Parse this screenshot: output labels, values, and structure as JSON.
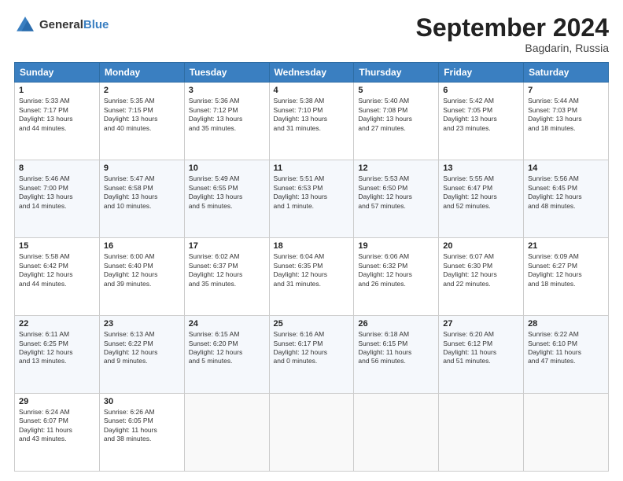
{
  "header": {
    "logo_general": "General",
    "logo_blue": "Blue",
    "title": "September 2024",
    "location": "Bagdarin, Russia"
  },
  "weekdays": [
    "Sunday",
    "Monday",
    "Tuesday",
    "Wednesday",
    "Thursday",
    "Friday",
    "Saturday"
  ],
  "weeks": [
    [
      {
        "day": "1",
        "lines": [
          "Sunrise: 5:33 AM",
          "Sunset: 7:17 PM",
          "Daylight: 13 hours",
          "and 44 minutes."
        ]
      },
      {
        "day": "2",
        "lines": [
          "Sunrise: 5:35 AM",
          "Sunset: 7:15 PM",
          "Daylight: 13 hours",
          "and 40 minutes."
        ]
      },
      {
        "day": "3",
        "lines": [
          "Sunrise: 5:36 AM",
          "Sunset: 7:12 PM",
          "Daylight: 13 hours",
          "and 35 minutes."
        ]
      },
      {
        "day": "4",
        "lines": [
          "Sunrise: 5:38 AM",
          "Sunset: 7:10 PM",
          "Daylight: 13 hours",
          "and 31 minutes."
        ]
      },
      {
        "day": "5",
        "lines": [
          "Sunrise: 5:40 AM",
          "Sunset: 7:08 PM",
          "Daylight: 13 hours",
          "and 27 minutes."
        ]
      },
      {
        "day": "6",
        "lines": [
          "Sunrise: 5:42 AM",
          "Sunset: 7:05 PM",
          "Daylight: 13 hours",
          "and 23 minutes."
        ]
      },
      {
        "day": "7",
        "lines": [
          "Sunrise: 5:44 AM",
          "Sunset: 7:03 PM",
          "Daylight: 13 hours",
          "and 18 minutes."
        ]
      }
    ],
    [
      {
        "day": "8",
        "lines": [
          "Sunrise: 5:46 AM",
          "Sunset: 7:00 PM",
          "Daylight: 13 hours",
          "and 14 minutes."
        ]
      },
      {
        "day": "9",
        "lines": [
          "Sunrise: 5:47 AM",
          "Sunset: 6:58 PM",
          "Daylight: 13 hours",
          "and 10 minutes."
        ]
      },
      {
        "day": "10",
        "lines": [
          "Sunrise: 5:49 AM",
          "Sunset: 6:55 PM",
          "Daylight: 13 hours",
          "and 5 minutes."
        ]
      },
      {
        "day": "11",
        "lines": [
          "Sunrise: 5:51 AM",
          "Sunset: 6:53 PM",
          "Daylight: 13 hours",
          "and 1 minute."
        ]
      },
      {
        "day": "12",
        "lines": [
          "Sunrise: 5:53 AM",
          "Sunset: 6:50 PM",
          "Daylight: 12 hours",
          "and 57 minutes."
        ]
      },
      {
        "day": "13",
        "lines": [
          "Sunrise: 5:55 AM",
          "Sunset: 6:47 PM",
          "Daylight: 12 hours",
          "and 52 minutes."
        ]
      },
      {
        "day": "14",
        "lines": [
          "Sunrise: 5:56 AM",
          "Sunset: 6:45 PM",
          "Daylight: 12 hours",
          "and 48 minutes."
        ]
      }
    ],
    [
      {
        "day": "15",
        "lines": [
          "Sunrise: 5:58 AM",
          "Sunset: 6:42 PM",
          "Daylight: 12 hours",
          "and 44 minutes."
        ]
      },
      {
        "day": "16",
        "lines": [
          "Sunrise: 6:00 AM",
          "Sunset: 6:40 PM",
          "Daylight: 12 hours",
          "and 39 minutes."
        ]
      },
      {
        "day": "17",
        "lines": [
          "Sunrise: 6:02 AM",
          "Sunset: 6:37 PM",
          "Daylight: 12 hours",
          "and 35 minutes."
        ]
      },
      {
        "day": "18",
        "lines": [
          "Sunrise: 6:04 AM",
          "Sunset: 6:35 PM",
          "Daylight: 12 hours",
          "and 31 minutes."
        ]
      },
      {
        "day": "19",
        "lines": [
          "Sunrise: 6:06 AM",
          "Sunset: 6:32 PM",
          "Daylight: 12 hours",
          "and 26 minutes."
        ]
      },
      {
        "day": "20",
        "lines": [
          "Sunrise: 6:07 AM",
          "Sunset: 6:30 PM",
          "Daylight: 12 hours",
          "and 22 minutes."
        ]
      },
      {
        "day": "21",
        "lines": [
          "Sunrise: 6:09 AM",
          "Sunset: 6:27 PM",
          "Daylight: 12 hours",
          "and 18 minutes."
        ]
      }
    ],
    [
      {
        "day": "22",
        "lines": [
          "Sunrise: 6:11 AM",
          "Sunset: 6:25 PM",
          "Daylight: 12 hours",
          "and 13 minutes."
        ]
      },
      {
        "day": "23",
        "lines": [
          "Sunrise: 6:13 AM",
          "Sunset: 6:22 PM",
          "Daylight: 12 hours",
          "and 9 minutes."
        ]
      },
      {
        "day": "24",
        "lines": [
          "Sunrise: 6:15 AM",
          "Sunset: 6:20 PM",
          "Daylight: 12 hours",
          "and 5 minutes."
        ]
      },
      {
        "day": "25",
        "lines": [
          "Sunrise: 6:16 AM",
          "Sunset: 6:17 PM",
          "Daylight: 12 hours",
          "and 0 minutes."
        ]
      },
      {
        "day": "26",
        "lines": [
          "Sunrise: 6:18 AM",
          "Sunset: 6:15 PM",
          "Daylight: 11 hours",
          "and 56 minutes."
        ]
      },
      {
        "day": "27",
        "lines": [
          "Sunrise: 6:20 AM",
          "Sunset: 6:12 PM",
          "Daylight: 11 hours",
          "and 51 minutes."
        ]
      },
      {
        "day": "28",
        "lines": [
          "Sunrise: 6:22 AM",
          "Sunset: 6:10 PM",
          "Daylight: 11 hours",
          "and 47 minutes."
        ]
      }
    ],
    [
      {
        "day": "29",
        "lines": [
          "Sunrise: 6:24 AM",
          "Sunset: 6:07 PM",
          "Daylight: 11 hours",
          "and 43 minutes."
        ]
      },
      {
        "day": "30",
        "lines": [
          "Sunrise: 6:26 AM",
          "Sunset: 6:05 PM",
          "Daylight: 11 hours",
          "and 38 minutes."
        ]
      },
      {
        "day": "",
        "lines": []
      },
      {
        "day": "",
        "lines": []
      },
      {
        "day": "",
        "lines": []
      },
      {
        "day": "",
        "lines": []
      },
      {
        "day": "",
        "lines": []
      }
    ]
  ]
}
